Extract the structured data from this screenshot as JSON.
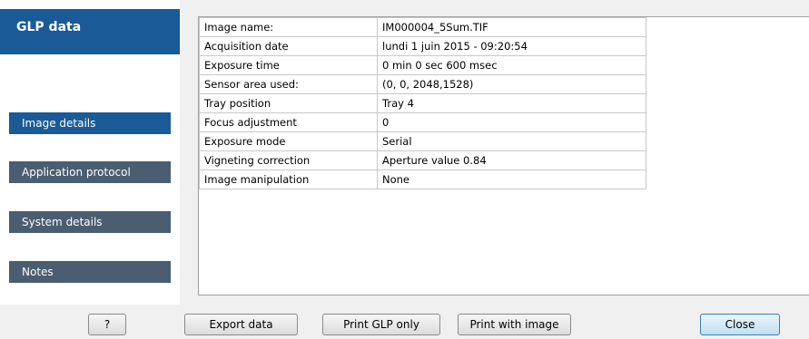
{
  "sidebar": {
    "title": "GLP data",
    "items": [
      {
        "label": "Image details",
        "active": true
      },
      {
        "label": "Application protocol",
        "active": false
      },
      {
        "label": "System details",
        "active": false
      },
      {
        "label": "Notes",
        "active": false
      }
    ]
  },
  "details": {
    "rows": [
      {
        "label": "Image name:",
        "value": "IM000004_5Sum.TIF"
      },
      {
        "label": "Acquisition date",
        "value": " lundi 1 juin 2015 - 09:20:54"
      },
      {
        "label": "Exposure time",
        "value": " 0 min 0 sec 600 msec"
      },
      {
        "label": "Sensor area used:",
        "value": "(0, 0, 2048,1528)"
      },
      {
        "label": "Tray position",
        "value": "Tray 4"
      },
      {
        "label": "Focus adjustment",
        "value": "0"
      },
      {
        "label": "Exposure mode",
        "value": "Serial"
      },
      {
        "label": "Vigneting correction",
        "value": "Aperture value 0.84"
      },
      {
        "label": "Image manipulation",
        "value": "None"
      }
    ]
  },
  "buttons": {
    "help": "?",
    "export": "Export data",
    "print_glp": "Print GLP only",
    "print_image": "Print with image",
    "close": "Close"
  },
  "colors": {
    "accent": "#1a5a96",
    "nav_inactive": "#4a5d71"
  }
}
